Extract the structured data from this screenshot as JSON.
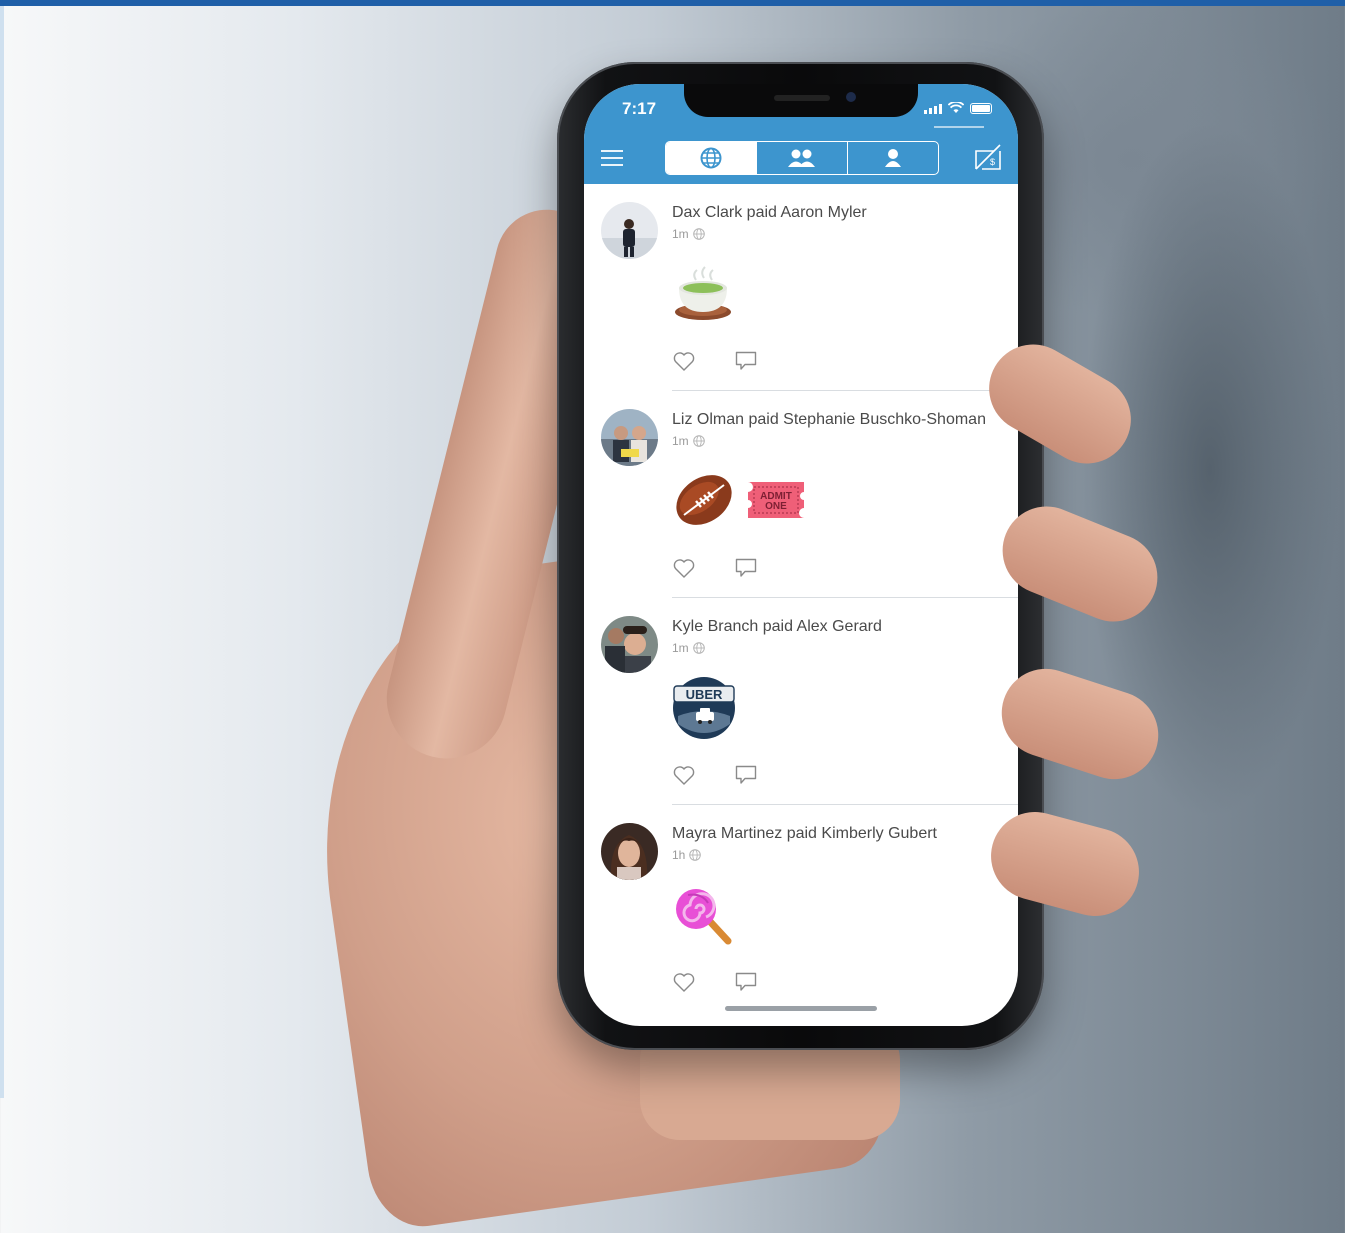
{
  "status_bar": {
    "time": "7:17"
  },
  "nav": {
    "tabs": [
      {
        "name": "public",
        "icon": "globe-icon",
        "active": true
      },
      {
        "name": "friends",
        "icon": "friends-icon",
        "active": false
      },
      {
        "name": "mine",
        "icon": "person-icon",
        "active": false
      }
    ],
    "accent": "#3d95ce"
  },
  "feed": [
    {
      "title": "Dax Clark paid Aaron Myler",
      "time": "1m",
      "emojis": [
        "green-tea-emoji"
      ]
    },
    {
      "title": "Liz Olman paid Stephanie Buschko-Shoman",
      "time": "1m",
      "emojis": [
        "football-emoji",
        "ticket-emoji"
      ]
    },
    {
      "title": "Kyle Branch paid Alex Gerard",
      "time": "1m",
      "emojis": [
        "uber-emoji"
      ]
    },
    {
      "title": "Mayra Martinez paid Kimberly Gubert",
      "time": "1h",
      "emojis": [
        "lollipop-emoji"
      ]
    }
  ],
  "ticket_text": {
    "line1": "ADMIT",
    "line2": "ONE"
  },
  "uber_text": "UBER"
}
